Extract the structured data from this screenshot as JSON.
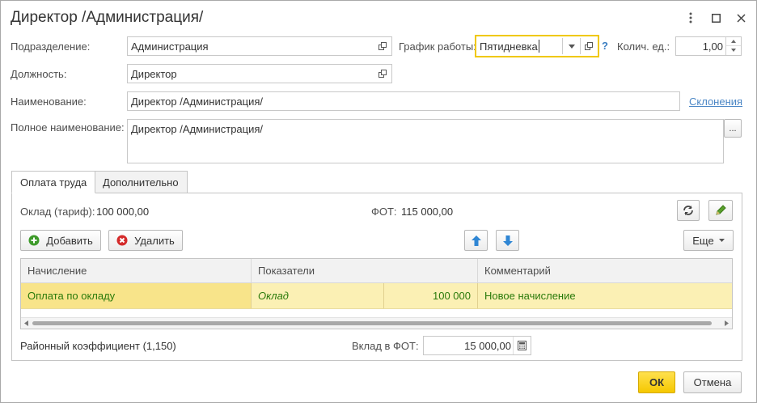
{
  "window": {
    "title": "Директор /Администрация/"
  },
  "form": {
    "subdivision_label": "Подразделение:",
    "subdivision_value": "Администрация",
    "schedule_label": "График работы:",
    "schedule_value": "Пятидневка",
    "help_mark": "?",
    "units_label": "Колич. ед.:",
    "units_value": "1,00",
    "position_label": "Должность:",
    "position_value": "Директор",
    "name_label": "Наименование:",
    "name_value": "Директор /Администрация/",
    "declensions_link": "Склонения",
    "fullname_label": "Полное наименование:",
    "fullname_value": "Директор /Администрация/",
    "ellipsis": "..."
  },
  "tabs": [
    {
      "label": "Оплата труда",
      "active": true
    },
    {
      "label": "Дополнительно",
      "active": false
    }
  ],
  "pay": {
    "salary_label": "Оклад (тариф):",
    "salary_value": "100 000,00",
    "fot_label": "ФОТ:",
    "fot_value": "115 000,00",
    "add_label": "Добавить",
    "delete_label": "Удалить",
    "more_label": "Еще",
    "columns": [
      "Начисление",
      "Показатели",
      "Комментарий"
    ],
    "rows": [
      {
        "accrual": "Оплата по окладу",
        "indicator": "Оклад",
        "amount": "100 000",
        "comment": "Новое начисление"
      }
    ],
    "district_label": "Районный коэффициент (1,150)",
    "contribution_label": "Вклад в ФОТ:",
    "contribution_value": "15 000,00"
  },
  "footer": {
    "ok_label": "ОК",
    "cancel_label": "Отмена"
  },
  "colors": {
    "accent_yellow": "#f5c800",
    "selected_row": "#fbf0b4",
    "link_blue": "#4a86c5",
    "green_text": "#2a7a0a"
  }
}
